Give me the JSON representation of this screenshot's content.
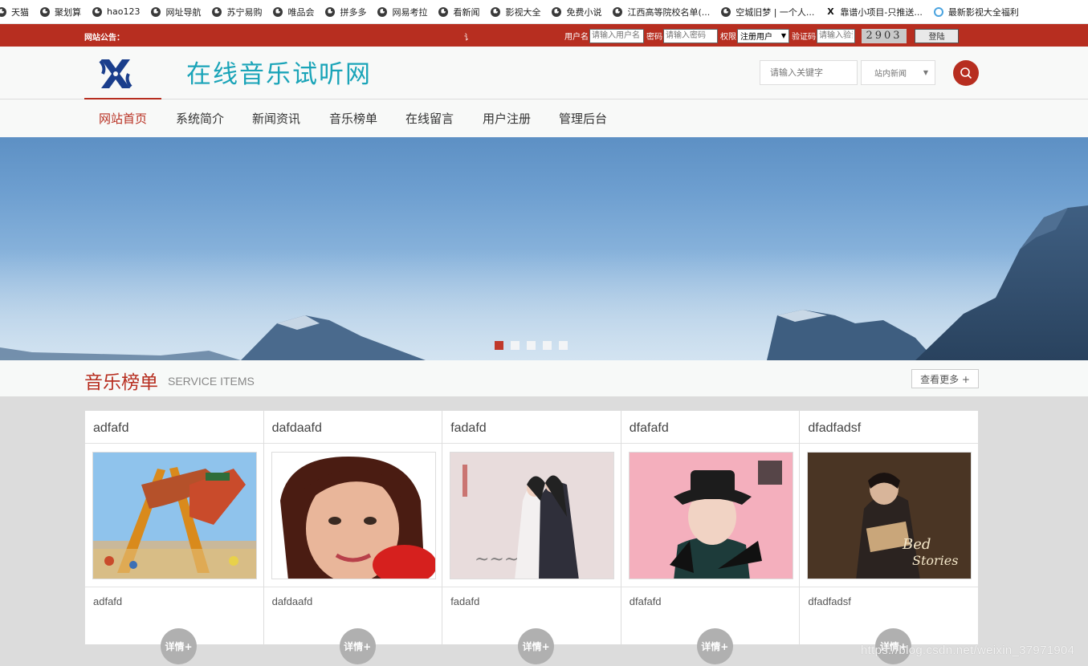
{
  "bookmarks": [
    {
      "label": "天猫",
      "icon": "globe-icon"
    },
    {
      "label": "聚划算",
      "icon": "globe-icon"
    },
    {
      "label": "hao123",
      "icon": "globe-icon"
    },
    {
      "label": "网址导航",
      "icon": "globe-icon"
    },
    {
      "label": "苏宁易购",
      "icon": "globe-icon"
    },
    {
      "label": "唯品会",
      "icon": "globe-icon"
    },
    {
      "label": "拼多多",
      "icon": "globe-icon"
    },
    {
      "label": "网易考拉",
      "icon": "globe-icon"
    },
    {
      "label": "看新闻",
      "icon": "globe-icon"
    },
    {
      "label": "影视大全",
      "icon": "globe-icon"
    },
    {
      "label": "免费小说",
      "icon": "globe-icon"
    },
    {
      "label": "江西高等院校名单(...",
      "icon": "globe-icon"
    },
    {
      "label": "空城旧梦 | 一个人...",
      "icon": "globe-icon"
    },
    {
      "label": "靠谱小项目-只推送...",
      "icon": "x-icon"
    },
    {
      "label": "最新影视大全福利",
      "icon": "swirl-icon"
    }
  ],
  "topbar": {
    "notice_label": "网站公告：",
    "notice_text": "讠",
    "username_label": "用户名",
    "username_placeholder": "请输入用户名",
    "password_label": "密码",
    "password_placeholder": "请输入密码",
    "role_label": "权限",
    "role_value": "注册用户",
    "captcha_label": "验证码",
    "captcha_placeholder": "请输入验证码",
    "captcha_code": "2903",
    "login_label": "登陆"
  },
  "header": {
    "site_title": "在线音乐试听网",
    "search_placeholder": "请输入关键字",
    "scope_value": "站内新闻"
  },
  "nav": {
    "items": [
      "网站首页",
      "系统简介",
      "新闻资讯",
      "音乐榜单",
      "在线留言",
      "用户注册",
      "管理后台"
    ],
    "active_index": 0
  },
  "banner": {
    "slide_count": 5,
    "active_slide": 1
  },
  "section": {
    "title": "音乐榜单",
    "subtitle": "SERVICE ITEMS",
    "more_label": "查看更多 +"
  },
  "cards": [
    {
      "title": "adfafd",
      "name": "adfafd",
      "detail": "详情+"
    },
    {
      "title": "dafdaafd",
      "name": "dafdaafd",
      "detail": "详情+"
    },
    {
      "title": "fadafd",
      "name": "fadafd",
      "detail": "详情+"
    },
    {
      "title": "dfafafd",
      "name": "dfafafd",
      "detail": "详情+"
    },
    {
      "title": "dfadfadsf",
      "name": "dfadfadsf",
      "detail": "详情+"
    }
  ],
  "watermark": "https://blog.csdn.net/weixin_37971904",
  "colors": {
    "brand_red": "#b72e20",
    "title_teal": "#1aa4b8"
  }
}
